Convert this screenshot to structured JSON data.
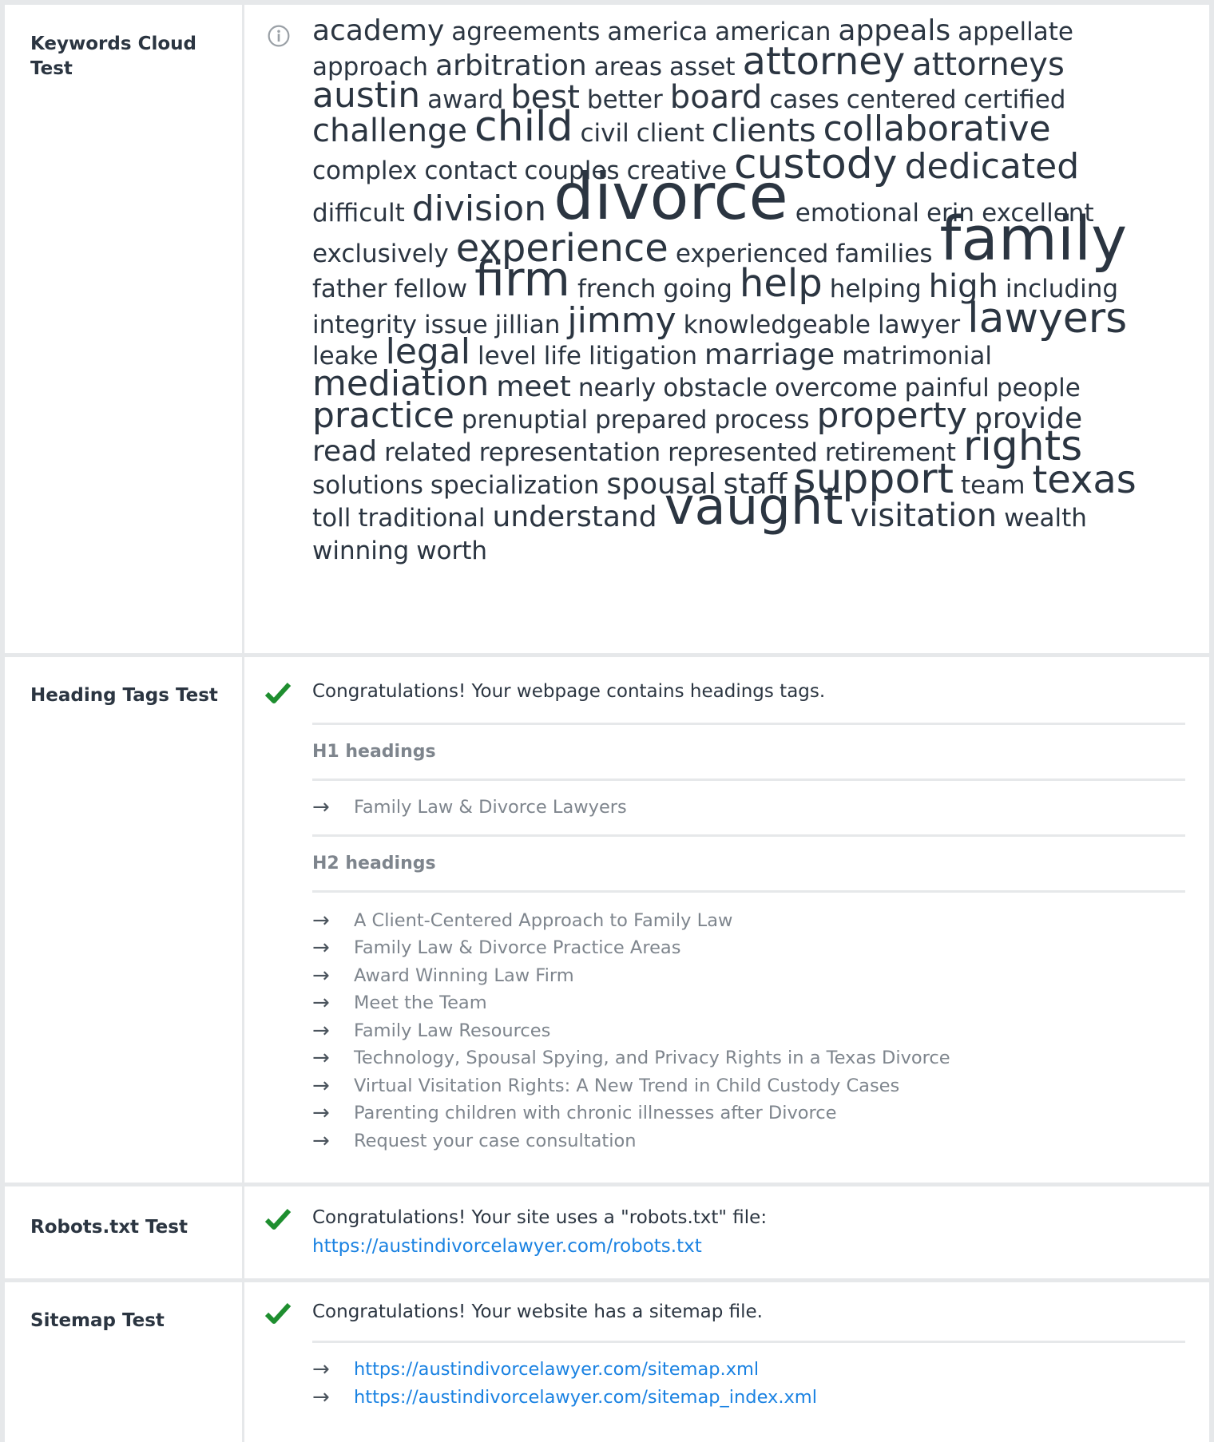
{
  "keywords_test": {
    "label": "Keywords Cloud Test",
    "icon": "info-icon",
    "words": [
      {
        "text": "academy",
        "size": 36
      },
      {
        "text": "agreements",
        "size": 31
      },
      {
        "text": "america",
        "size": 31
      },
      {
        "text": "american",
        "size": 31
      },
      {
        "text": "appeals",
        "size": 36
      },
      {
        "text": "appellate",
        "size": 31
      },
      {
        "text": "approach",
        "size": 31
      },
      {
        "text": "arbitration",
        "size": 36
      },
      {
        "text": "areas",
        "size": 31
      },
      {
        "text": "asset",
        "size": 31
      },
      {
        "text": "attorney",
        "size": 48
      },
      {
        "text": "attorneys",
        "size": 40
      },
      {
        "text": "austin",
        "size": 44
      },
      {
        "text": "award",
        "size": 31
      },
      {
        "text": "best",
        "size": 40
      },
      {
        "text": "better",
        "size": 31
      },
      {
        "text": "board",
        "size": 40
      },
      {
        "text": "cases",
        "size": 31
      },
      {
        "text": "centered",
        "size": 31
      },
      {
        "text": "certified",
        "size": 31
      },
      {
        "text": "challenge",
        "size": 40
      },
      {
        "text": "child",
        "size": 52
      },
      {
        "text": "civil",
        "size": 31
      },
      {
        "text": "client",
        "size": 31
      },
      {
        "text": "clients",
        "size": 40
      },
      {
        "text": "collaborative",
        "size": 44
      },
      {
        "text": "complex",
        "size": 31
      },
      {
        "text": "contact",
        "size": 31
      },
      {
        "text": "couples",
        "size": 31
      },
      {
        "text": "creative",
        "size": 31
      },
      {
        "text": "custody",
        "size": 52
      },
      {
        "text": "dedicated",
        "size": 44
      },
      {
        "text": "difficult",
        "size": 31
      },
      {
        "text": "division",
        "size": 44
      },
      {
        "text": "divorce",
        "size": 80
      },
      {
        "text": "emotional",
        "size": 31
      },
      {
        "text": "erin",
        "size": 31
      },
      {
        "text": "excellent",
        "size": 31
      },
      {
        "text": "exclusively",
        "size": 31
      },
      {
        "text": "experience",
        "size": 48
      },
      {
        "text": "experienced",
        "size": 31
      },
      {
        "text": "families",
        "size": 31
      },
      {
        "text": "family",
        "size": 76
      },
      {
        "text": "father",
        "size": 31
      },
      {
        "text": "fellow",
        "size": 31
      },
      {
        "text": "firm",
        "size": 60
      },
      {
        "text": "french",
        "size": 31
      },
      {
        "text": "going",
        "size": 31
      },
      {
        "text": "help",
        "size": 48
      },
      {
        "text": "helping",
        "size": 31
      },
      {
        "text": "high",
        "size": 40
      },
      {
        "text": "including",
        "size": 31
      },
      {
        "text": "integrity",
        "size": 31
      },
      {
        "text": "issue",
        "size": 31
      },
      {
        "text": "jillian",
        "size": 31
      },
      {
        "text": "jimmy",
        "size": 44
      },
      {
        "text": "knowledgeable",
        "size": 31
      },
      {
        "text": "lawyer",
        "size": 31
      },
      {
        "text": "lawyers",
        "size": 52
      },
      {
        "text": "leake",
        "size": 31
      },
      {
        "text": "legal",
        "size": 44
      },
      {
        "text": "level",
        "size": 31
      },
      {
        "text": "life",
        "size": 31
      },
      {
        "text": "litigation",
        "size": 31
      },
      {
        "text": "marriage",
        "size": 36
      },
      {
        "text": "matrimonial",
        "size": 31
      },
      {
        "text": "mediation",
        "size": 44
      },
      {
        "text": "meet",
        "size": 36
      },
      {
        "text": "nearly",
        "size": 31
      },
      {
        "text": "obstacle",
        "size": 31
      },
      {
        "text": "overcome",
        "size": 31
      },
      {
        "text": "painful",
        "size": 31
      },
      {
        "text": "people",
        "size": 31
      },
      {
        "text": "practice",
        "size": 44
      },
      {
        "text": "prenuptial",
        "size": 31
      },
      {
        "text": "prepared",
        "size": 31
      },
      {
        "text": "process",
        "size": 31
      },
      {
        "text": "property",
        "size": 44
      },
      {
        "text": "provide",
        "size": 36
      },
      {
        "text": "read",
        "size": 36
      },
      {
        "text": "related",
        "size": 31
      },
      {
        "text": "representation",
        "size": 31
      },
      {
        "text": "represented",
        "size": 31
      },
      {
        "text": "retirement",
        "size": 31
      },
      {
        "text": "rights",
        "size": 52
      },
      {
        "text": "solutions",
        "size": 31
      },
      {
        "text": "specialization",
        "size": 31
      },
      {
        "text": "spousal",
        "size": 36
      },
      {
        "text": "staff",
        "size": 36
      },
      {
        "text": "support",
        "size": 52
      },
      {
        "text": "team",
        "size": 31
      },
      {
        "text": "texas",
        "size": 48
      },
      {
        "text": "toll",
        "size": 31
      },
      {
        "text": "traditional",
        "size": 31
      },
      {
        "text": "understand",
        "size": 36
      },
      {
        "text": "vaught",
        "size": 64
      },
      {
        "text": "visitation",
        "size": 40
      },
      {
        "text": "wealth",
        "size": 31
      },
      {
        "text": "winning",
        "size": 31
      },
      {
        "text": "worth",
        "size": 31
      }
    ]
  },
  "heading_test": {
    "label": "Heading Tags Test",
    "icon": "check-icon",
    "message": "Congratulations! Your webpage contains headings tags.",
    "h1_title": "H1 headings",
    "h1": [
      "Family Law & Divorce Lawyers"
    ],
    "h2_title": "H2 headings",
    "h2": [
      "A Client-Centered Approach to Family Law",
      "Family Law & Divorce Practice Areas",
      "Award Winning Law Firm",
      "Meet the Team",
      "Family Law Resources",
      "Technology, Spousal Spying, and Privacy Rights in a Texas Divorce",
      "Virtual Visitation Rights: A New Trend in Child Custody Cases",
      "Parenting children with chronic illnesses after Divorce",
      "Request your case consultation"
    ]
  },
  "robots_test": {
    "label": "Robots.txt Test",
    "icon": "check-icon",
    "message": "Congratulations! Your site uses a \"robots.txt\" file:",
    "url": "https://austindivorcelawyer.com/robots.txt"
  },
  "sitemap_test": {
    "label": "Sitemap Test",
    "icon": "check-icon",
    "message": "Congratulations! Your website has a sitemap file.",
    "urls": [
      "https://austindivorcelawyer.com/sitemap.xml",
      "https://austindivorcelawyer.com/sitemap_index.xml"
    ]
  },
  "colors": {
    "text": "#2b3541",
    "muted": "#7e858d",
    "link": "#1a82e2",
    "check": "#1e8e2f",
    "divider": "#e6e8ea"
  }
}
